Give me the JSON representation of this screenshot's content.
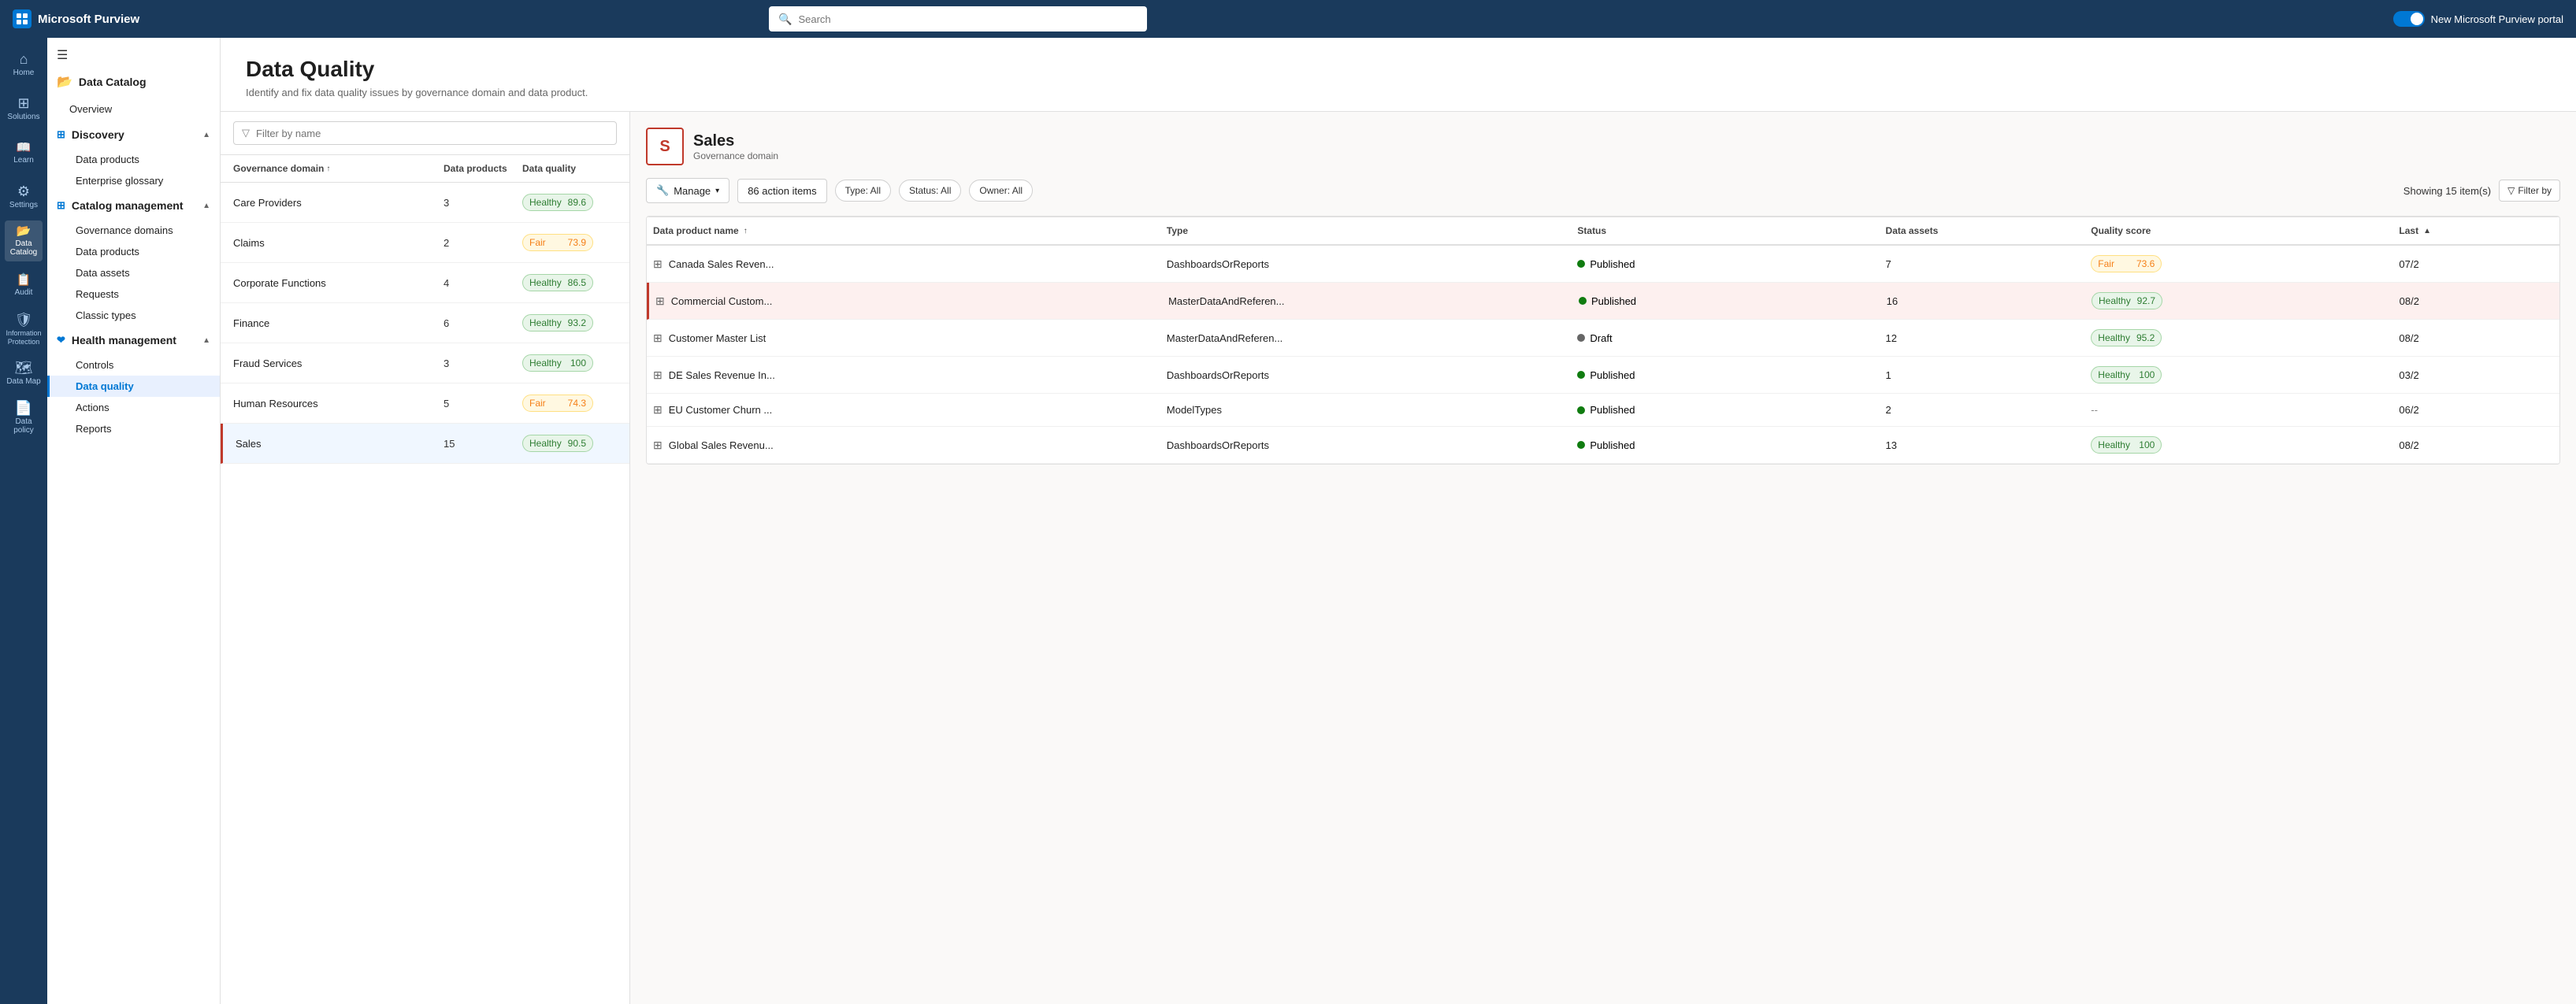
{
  "app": {
    "brand": "Microsoft Purview",
    "search_placeholder": "Search",
    "new_purview_portal_label": "New Microsoft Purview portal"
  },
  "left_sidebar": {
    "items": [
      {
        "id": "home",
        "icon": "⌂",
        "label": "Home"
      },
      {
        "id": "solutions",
        "icon": "⊞",
        "label": "Solutions"
      },
      {
        "id": "learn",
        "icon": "📖",
        "label": "Learn"
      },
      {
        "id": "settings",
        "icon": "⚙",
        "label": "Settings"
      },
      {
        "id": "data-catalog",
        "icon": "📂",
        "label": "Data Catalog",
        "active": true
      },
      {
        "id": "audit",
        "icon": "📋",
        "label": "Audit"
      },
      {
        "id": "info-protection",
        "icon": "🛡",
        "label": "Information Protection"
      },
      {
        "id": "data-map",
        "icon": "🗺",
        "label": "Data Map"
      },
      {
        "id": "data-policy",
        "icon": "📄",
        "label": "Data policy"
      }
    ]
  },
  "nav_panel": {
    "sections": [
      {
        "id": "data-catalog",
        "title": "Data Catalog",
        "icon": "📂",
        "items": [
          {
            "id": "overview",
            "label": "Overview",
            "level": 1
          }
        ]
      },
      {
        "id": "discovery",
        "title": "Discovery",
        "icon": "🔍",
        "collapsed": false,
        "items": [
          {
            "id": "data-products",
            "label": "Data products",
            "level": 2
          },
          {
            "id": "enterprise-glossary",
            "label": "Enterprise glossary",
            "level": 2
          }
        ]
      },
      {
        "id": "catalog-management",
        "title": "Catalog management",
        "icon": "⚙",
        "collapsed": false,
        "items": [
          {
            "id": "governance-domains",
            "label": "Governance domains",
            "level": 2
          },
          {
            "id": "data-products-mgmt",
            "label": "Data products",
            "level": 2
          },
          {
            "id": "data-assets",
            "label": "Data assets",
            "level": 2
          },
          {
            "id": "requests",
            "label": "Requests",
            "level": 2
          },
          {
            "id": "classic-types",
            "label": "Classic types",
            "level": 2
          }
        ]
      },
      {
        "id": "health-management",
        "title": "Health management",
        "icon": "❤",
        "collapsed": false,
        "items": [
          {
            "id": "controls",
            "label": "Controls",
            "level": 2
          },
          {
            "id": "data-quality",
            "label": "Data quality",
            "level": 2,
            "active": true
          },
          {
            "id": "actions",
            "label": "Actions",
            "level": 2
          },
          {
            "id": "reports",
            "label": "Reports",
            "level": 2
          }
        ]
      }
    ]
  },
  "page": {
    "title": "Data Quality",
    "subtitle": "Identify and fix data quality issues by governance domain and data product.",
    "filter_placeholder": "Filter by name"
  },
  "domain_table": {
    "columns": [
      {
        "id": "governance-domain",
        "label": "Governance domain",
        "sort": "asc"
      },
      {
        "id": "data-products",
        "label": "Data products"
      },
      {
        "id": "data-quality",
        "label": "Data quality"
      }
    ],
    "rows": [
      {
        "id": "care-providers",
        "name": "Care Providers",
        "products": 3,
        "quality_label": "Healthy",
        "quality_score": 89.6,
        "status": "healthy"
      },
      {
        "id": "claims",
        "name": "Claims",
        "products": 2,
        "quality_label": "Fair",
        "quality_score": 73.9,
        "status": "fair"
      },
      {
        "id": "corporate-functions",
        "name": "Corporate Functions",
        "products": 4,
        "quality_label": "Healthy",
        "quality_score": 86.5,
        "status": "healthy"
      },
      {
        "id": "finance",
        "name": "Finance",
        "products": 6,
        "quality_label": "Healthy",
        "quality_score": 93.2,
        "status": "healthy"
      },
      {
        "id": "fraud-services",
        "name": "Fraud Services",
        "products": 3,
        "quality_label": "Healthy",
        "quality_score": 100,
        "status": "healthy"
      },
      {
        "id": "human-resources",
        "name": "Human Resources",
        "products": 5,
        "quality_label": "Fair",
        "quality_score": 74.3,
        "status": "fair"
      },
      {
        "id": "sales",
        "name": "Sales",
        "products": 15,
        "quality_label": "Healthy",
        "quality_score": 90.5,
        "status": "healthy",
        "selected": true
      }
    ]
  },
  "detail_panel": {
    "domain": {
      "avatar_letter": "S",
      "name": "Sales",
      "type": "Governance domain"
    },
    "toolbar": {
      "manage_label": "Manage",
      "action_items_label": "86 action items",
      "type_filter_label": "Type: All",
      "status_filter_label": "Status: All",
      "owner_filter_label": "Owner: All",
      "showing_label": "Showing 15 item(s)",
      "filter_button_label": "Filter by"
    },
    "products_table": {
      "columns": [
        {
          "id": "name",
          "label": "Data product name",
          "sort": "asc"
        },
        {
          "id": "type",
          "label": "Type"
        },
        {
          "id": "status",
          "label": "Status"
        },
        {
          "id": "data-assets",
          "label": "Data assets"
        },
        {
          "id": "quality-score",
          "label": "Quality score"
        },
        {
          "id": "last",
          "label": "Last",
          "sort": "desc"
        }
      ],
      "rows": [
        {
          "id": "canada-sales",
          "name": "Canada Sales Reven...",
          "type": "DashboardsOrReports",
          "status": "Published",
          "status_type": "published",
          "data_assets": 7,
          "quality_label": "Fair",
          "quality_score": 73.6,
          "quality_status": "fair",
          "last": "07/2",
          "selected": false
        },
        {
          "id": "commercial-custom",
          "name": "Commercial Custom...",
          "type": "MasterDataAndReferen...",
          "status": "Published",
          "status_type": "published",
          "data_assets": 16,
          "quality_label": "Healthy",
          "quality_score": 92.7,
          "quality_status": "healthy",
          "last": "08/2",
          "selected": true
        },
        {
          "id": "customer-master",
          "name": "Customer Master List",
          "type": "MasterDataAndReferen...",
          "status": "Draft",
          "status_type": "draft",
          "data_assets": 12,
          "quality_label": "Healthy",
          "quality_score": 95.2,
          "quality_status": "healthy",
          "last": "08/2",
          "selected": false
        },
        {
          "id": "de-sales-revenue",
          "name": "DE Sales Revenue In...",
          "type": "DashboardsOrReports",
          "status": "Published",
          "status_type": "published",
          "data_assets": 1,
          "quality_label": "Healthy",
          "quality_score": 100,
          "quality_status": "healthy",
          "last": "03/2",
          "selected": false
        },
        {
          "id": "eu-customer-churn",
          "name": "EU Customer Churn ...",
          "type": "ModelTypes",
          "status": "Published",
          "status_type": "published",
          "data_assets": 2,
          "quality_label": "--",
          "quality_score": null,
          "quality_status": "none",
          "last": "06/2",
          "selected": false
        },
        {
          "id": "global-sales-revenue",
          "name": "Global Sales Revenu...",
          "type": "DashboardsOrReports",
          "status": "Published",
          "status_type": "published",
          "data_assets": 13,
          "quality_label": "Healthy",
          "quality_score": 100,
          "quality_status": "healthy",
          "last": "08/2",
          "selected": false
        }
      ]
    }
  }
}
